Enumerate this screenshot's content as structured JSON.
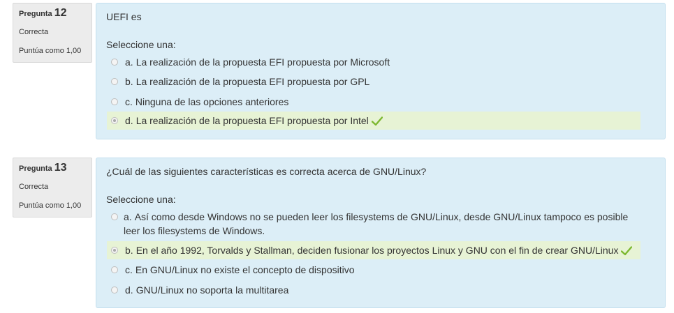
{
  "questions": [
    {
      "label": "Pregunta",
      "number": "12",
      "state": "Correcta",
      "grade": "Puntúa como 1,00",
      "text": "UEFI es",
      "prompt": "Seleccione una:",
      "options": [
        {
          "letter": "a.",
          "text": "La realización de la propuesta EFI propuesta por Microsoft",
          "selected": false,
          "correct": false
        },
        {
          "letter": "b.",
          "text": "La realización de la propuesta EFI propuesta por GPL",
          "selected": false,
          "correct": false
        },
        {
          "letter": "c.",
          "text": "Ninguna de las opciones anteriores",
          "selected": false,
          "correct": false
        },
        {
          "letter": "d.",
          "text": "La realización de la propuesta EFI propuesta por Intel",
          "selected": true,
          "correct": true
        }
      ]
    },
    {
      "label": "Pregunta",
      "number": "13",
      "state": "Correcta",
      "grade": "Puntúa como 1,00",
      "text": "¿Cuál de las siguientes características es correcta acerca de GNU/Linux?",
      "prompt": "Seleccione una:",
      "options": [
        {
          "letter": "a.",
          "text": "Así como desde Windows no se pueden leer los filesystems de GNU/Linux, desde GNU/Linux tampoco es posible leer los filesystems de Windows.",
          "selected": false,
          "correct": false
        },
        {
          "letter": "b.",
          "text": "En el año 1992, Torvalds y Stallman, deciden fusionar los proyectos Linux y GNU con el fin de crear GNU/Linux",
          "selected": true,
          "correct": true
        },
        {
          "letter": "c.",
          "text": "En GNU/Linux no existe el concepto de dispositivo",
          "selected": false,
          "correct": false
        },
        {
          "letter": "d.",
          "text": "GNU/Linux no soporta la multitarea",
          "selected": false,
          "correct": false
        }
      ]
    }
  ],
  "colors": {
    "info_bg": "#ececec",
    "content_bg": "#dceef7",
    "correct_bg": "#e7f3d5",
    "check": "#7cb82f"
  },
  "icons": {
    "correct": "check-icon",
    "radio": "radio-icon"
  }
}
